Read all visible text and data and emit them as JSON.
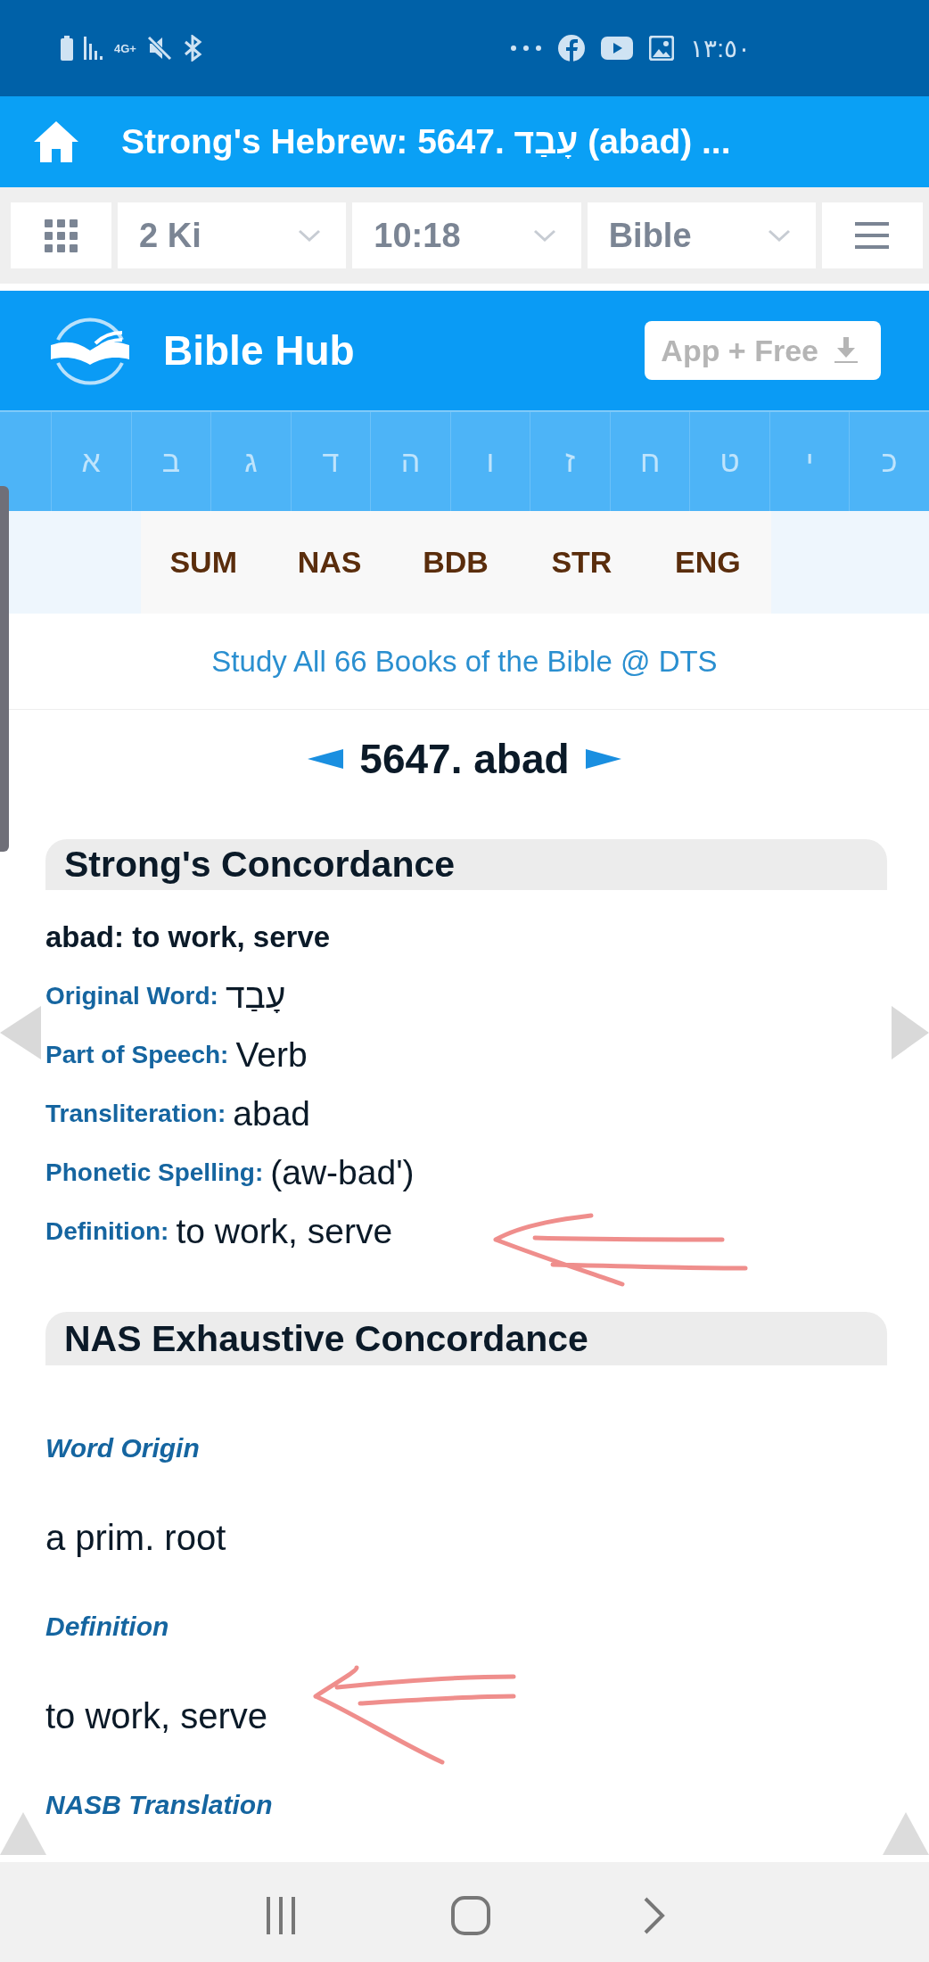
{
  "status_bar": {
    "network": "4G+",
    "time": "١٣:٥٠"
  },
  "title_bar": {
    "title": "Strong's Hebrew: 5647. עָבַד (abad) ..."
  },
  "nav": {
    "selects": [
      {
        "value": "2 Ki"
      },
      {
        "value": "10:18"
      },
      {
        "value": "Bible"
      }
    ]
  },
  "header": {
    "site_name": "Bible Hub",
    "app_button": "App + Free"
  },
  "letters": [
    "כ",
    "י",
    "ט",
    "ח",
    "ז",
    "ו",
    "ה",
    "ד",
    "ג",
    "ב",
    "א"
  ],
  "tabs": [
    "SUM",
    "NAS",
    "BDB",
    "STR",
    "ENG"
  ],
  "promo": "Study All 66 Books of the Bible @ DTS",
  "entry_title": "5647. abad",
  "strongs": {
    "title": "Strong's Concordance",
    "summary": "abad: to work, serve",
    "fields": [
      {
        "label": "Original Word:",
        "value": "עָבַד"
      },
      {
        "label": "Part of Speech:",
        "value": "Verb"
      },
      {
        "label": "Transliteration:",
        "value": "abad"
      },
      {
        "label": "Phonetic Spelling:",
        "value": "(aw-bad')"
      },
      {
        "label": "Definition:",
        "value": "to work, serve"
      }
    ]
  },
  "nas": {
    "title": "NAS Exhaustive Concordance",
    "sections": [
      {
        "heading": "Word Origin",
        "text": "a prim. root"
      },
      {
        "heading": "Definition",
        "text": "to work, serve"
      },
      {
        "heading": "NASB Translation"
      }
    ]
  }
}
